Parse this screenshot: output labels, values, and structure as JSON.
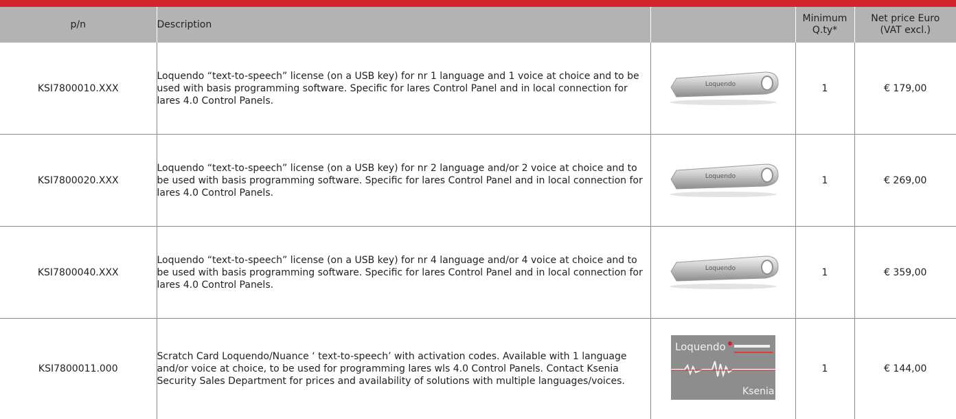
{
  "header": {
    "pn": "p/n",
    "description": "Description",
    "min_qty_line1": "Minimum",
    "min_qty_line2": "Q.ty*",
    "price_line1": "Net price Euro",
    "price_line2": "(VAT excl.)"
  },
  "rows": [
    {
      "pn": "KSI7800010.XXX",
      "description": "Loquendo “text-to-speech” license (on a USB key) for nr 1 language and 1 voice at choice and to be used with basis programming software. Specific for lares Control Panel and in local connection for lares 4.0 Control Panels.",
      "image_label": "Loquendo",
      "qty": "1",
      "price": "€ 179,00"
    },
    {
      "pn": "KSI7800020.XXX",
      "description": "Loquendo “text-to-speech” license (on a USB key) for nr 2 language and/or 2 voice at choice and to be used with basis programming software. Specific for lares Control Panel and in local connection for lares 4.0 Control Panels.",
      "image_label": "Loquendo",
      "qty": "1",
      "price": "€ 269,00"
    },
    {
      "pn": "KSI7800040.XXX",
      "description": "Loquendo “text-to-speech” license (on a USB key) for nr 4 language and/or 4 voice at choice and to be used with basis programming software. Specific for lares Control Panel and in local connection for lares 4.0 Control Panels.",
      "image_label": "Loquendo",
      "qty": "1",
      "price": "€ 359,00"
    },
    {
      "pn": "KSI7800011.000",
      "description": "Scratch Card Loquendo/Nuance ‘ text-to-speech’ with activation codes. Available with 1 language and/or voice at choice, to be used for programming lares wls 4.0 Control Panels. Contact Ksenia Security Sales Department for prices and availability of solutions with multiple languages/voices.",
      "image_label": "Loquendo",
      "image_brand": "Ksenia",
      "qty": "1",
      "price": "€ 144,00"
    }
  ],
  "colors": {
    "top_bar": "#d3242d",
    "header_bg": "#b3b3b3",
    "border": "#8a8a8a"
  }
}
